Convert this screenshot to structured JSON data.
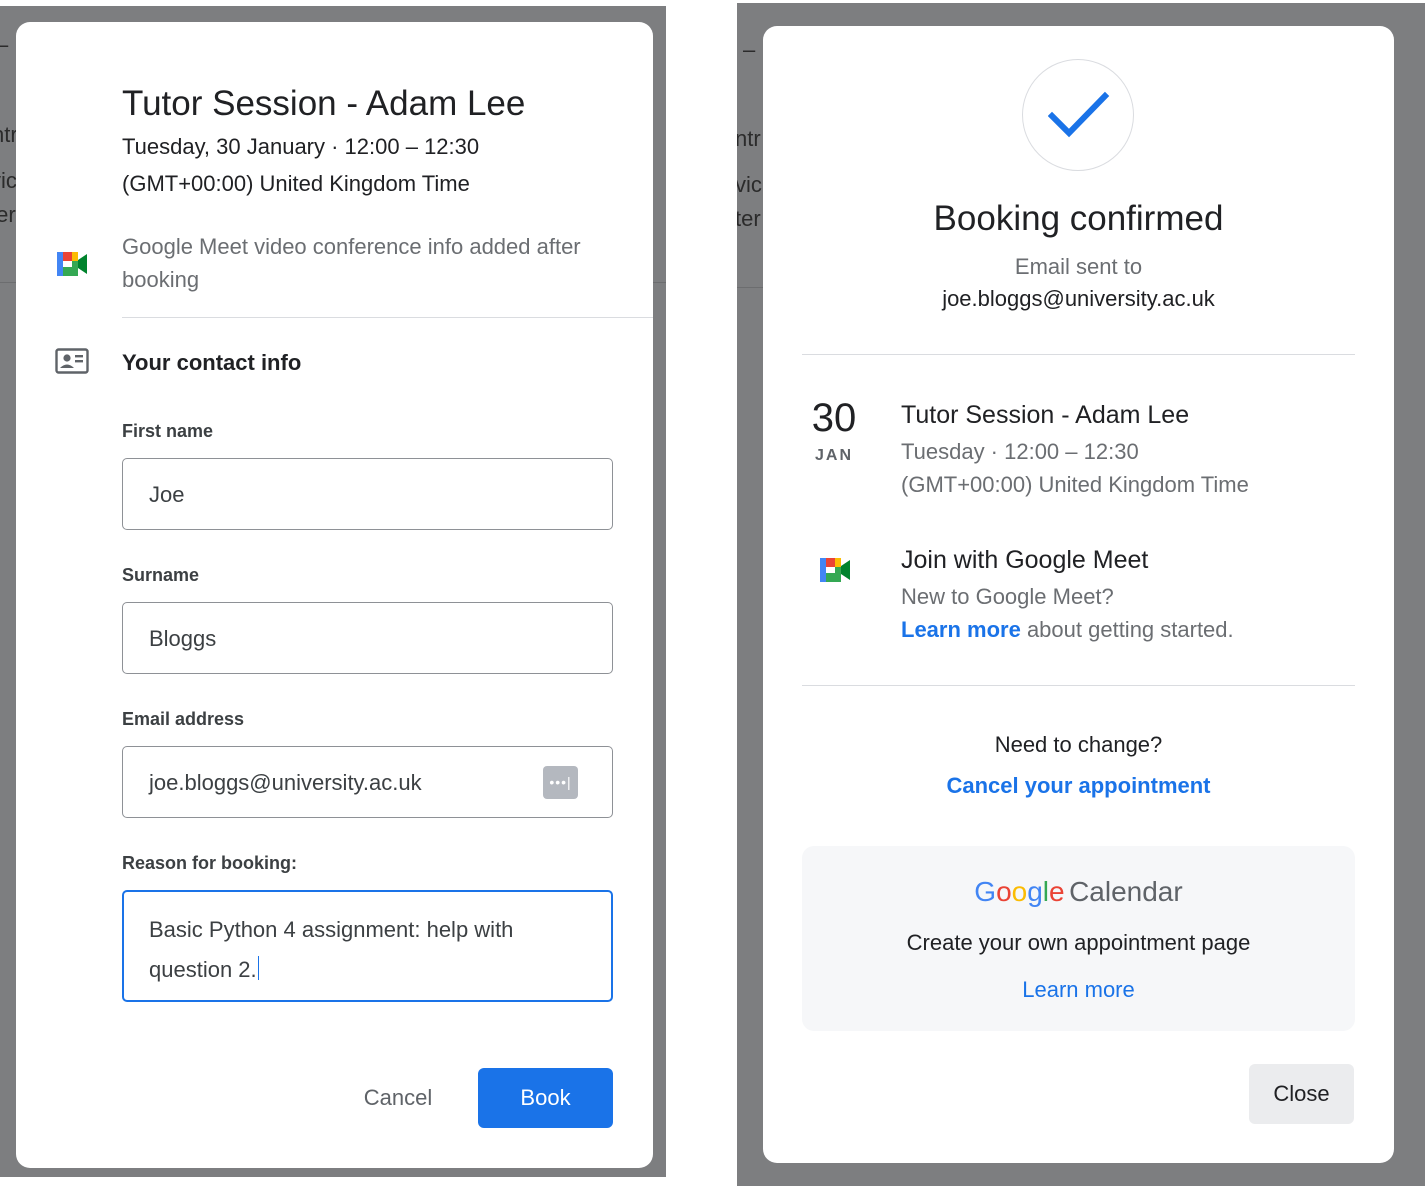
{
  "background": {
    "left_fragments": [
      "–",
      "ntr",
      "vic",
      "ter"
    ],
    "right_fragments": [
      "–",
      "ntr",
      "vic",
      "ter"
    ]
  },
  "booking": {
    "title": "Tutor Session - Adam Lee",
    "date_time": "Tuesday, 30 January · 12:00 – 12:30",
    "timezone": "(GMT+00:00) United Kingdom Time",
    "meet_note": "Google Meet video conference info added after booking",
    "contact_section": "Your contact info",
    "first_name_label": "First name",
    "first_name_value": "Joe",
    "surname_label": "Surname",
    "surname_value": "Bloggs",
    "email_label": "Email address",
    "email_value": "joe.bloggs@university.ac.uk",
    "autofill_glyph": "•••|",
    "reason_label": "Reason for booking:",
    "reason_value": "Basic Python 4 assignment: help with question 2.",
    "cancel_label": "Cancel",
    "book_label": "Book"
  },
  "confirmation": {
    "title": "Booking confirmed",
    "email_sent_label": "Email sent to",
    "email": "joe.bloggs@university.ac.uk",
    "event": {
      "day": "30",
      "month": "JAN",
      "title": "Tutor Session - Adam Lee",
      "time": "Tuesday · 12:00 – 12:30",
      "timezone": "(GMT+00:00) United Kingdom Time"
    },
    "meet": {
      "title": "Join with Google Meet",
      "new_to": "New to Google Meet?",
      "learn_more": "Learn more",
      "learn_more_suffix": " about getting started."
    },
    "change_prompt": "Need to change?",
    "cancel_link": "Cancel your appointment",
    "promo": {
      "calendar_word": "Calendar",
      "tagline": "Create your own appointment page",
      "learn_more": "Learn more"
    },
    "close_label": "Close"
  },
  "colors": {
    "accent_blue": "#1a73e8",
    "backdrop": "#7d7e80",
    "google_blue": "#4285f4",
    "google_red": "#ea4335",
    "google_yellow": "#fbbc04",
    "google_green": "#34a853"
  },
  "icons": {
    "meet": "google-meet-icon",
    "contact": "contact-card-icon",
    "check": "checkmark-icon",
    "autofill": "password-manager-icon"
  }
}
